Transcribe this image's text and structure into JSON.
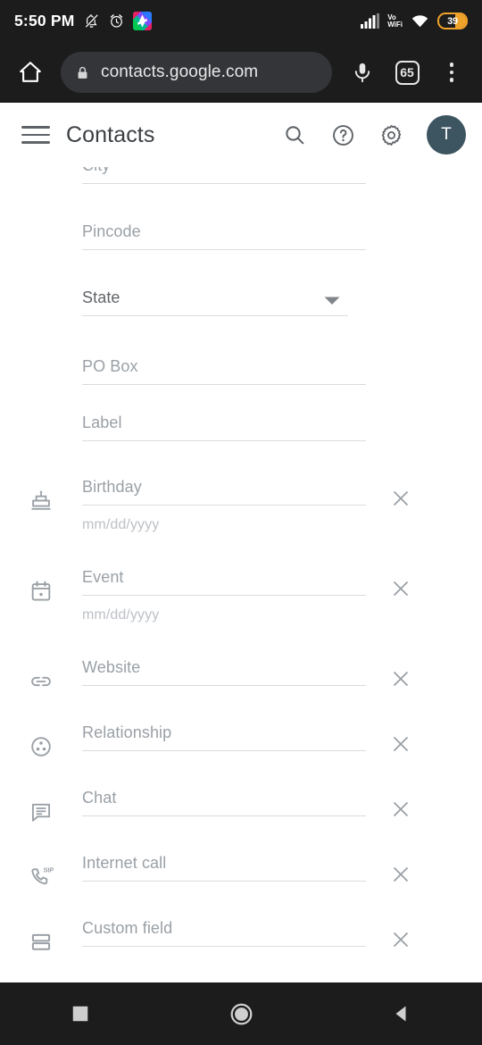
{
  "status_bar": {
    "time": "5:50 PM",
    "icons": [
      "bell-off-icon",
      "alarm-clock-icon",
      "app-badge-icon"
    ],
    "signal": "signal-bars-icon",
    "volte": "Vo\nWiFi",
    "volte_line1": "Vo",
    "volte_line2": "WiFi",
    "wifi": "wifi-icon",
    "battery_percent": "39",
    "battery_color": "#f0a32a"
  },
  "browser": {
    "home_label": "home-icon",
    "lock_label": "lock-icon",
    "url": "contacts.google.com",
    "mic_label": "microphone-icon",
    "tab_count": "65",
    "menu_label": "overflow-menu-icon"
  },
  "app_header": {
    "menu_label": "hamburger-menu",
    "title": "Contacts",
    "search_label": "search-icon",
    "help_label": "help-icon",
    "settings_label": "settings-gear-icon",
    "avatar_initial": "T"
  },
  "form": {
    "fields": [
      {
        "label": "City",
        "icon": null,
        "hint": null,
        "clearable": false,
        "dropdown": false,
        "clipped": true,
        "label_dark": false
      },
      {
        "label": "Pincode",
        "icon": null,
        "hint": null,
        "clearable": false,
        "dropdown": false,
        "clipped": false,
        "label_dark": false
      },
      {
        "label": "State",
        "icon": null,
        "hint": null,
        "clearable": false,
        "dropdown": true,
        "clipped": false,
        "label_dark": true
      },
      {
        "label": "PO Box",
        "icon": null,
        "hint": null,
        "clearable": false,
        "dropdown": false,
        "clipped": false,
        "label_dark": false
      },
      {
        "label": "Label",
        "icon": null,
        "hint": null,
        "clearable": false,
        "dropdown": false,
        "clipped": false,
        "label_dark": false
      },
      {
        "label": "Birthday",
        "icon": "cake-icon",
        "hint": "mm/dd/yyyy",
        "clearable": true,
        "dropdown": false,
        "clipped": false,
        "label_dark": false
      },
      {
        "label": "Event",
        "icon": "calendar-icon",
        "hint": "mm/dd/yyyy",
        "clearable": true,
        "dropdown": false,
        "clipped": false,
        "label_dark": false
      },
      {
        "label": "Website",
        "icon": "link-icon",
        "hint": null,
        "clearable": true,
        "dropdown": false,
        "clipped": false,
        "label_dark": false
      },
      {
        "label": "Relationship",
        "icon": "relationship-icon",
        "hint": null,
        "clearable": true,
        "dropdown": false,
        "clipped": false,
        "label_dark": false
      },
      {
        "label": "Chat",
        "icon": "chat-bubble-icon",
        "hint": null,
        "clearable": true,
        "dropdown": false,
        "clipped": false,
        "label_dark": false
      },
      {
        "label": "Internet call",
        "icon": "sip-phone-icon",
        "hint": null,
        "clearable": true,
        "dropdown": false,
        "clipped": false,
        "label_dark": false
      },
      {
        "label": "Custom field",
        "icon": "custom-field-icon",
        "hint": null,
        "clearable": true,
        "dropdown": false,
        "clipped": false,
        "label_dark": false
      }
    ],
    "clear_icon": "close-x-icon",
    "dropdown_icon": "caret-down-icon"
  },
  "nav_bar": {
    "recents_label": "recents-square-icon",
    "home_label": "home-circle-icon",
    "back_label": "back-triangle-icon"
  }
}
